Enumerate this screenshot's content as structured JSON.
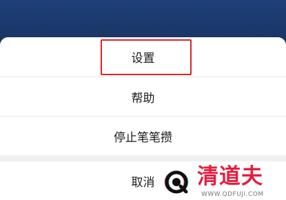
{
  "menu": {
    "items": [
      {
        "label": "设置"
      },
      {
        "label": "帮助"
      },
      {
        "label": "停止笔笔攒"
      }
    ],
    "cancel_label": "取消"
  },
  "annotation": {
    "highlight_color": "#e02020",
    "highlighted_item": "设置"
  },
  "watermark": {
    "brand": "清道夫",
    "url": "WWW.QDFUJI.COM"
  },
  "colors": {
    "backdrop": "#1e3f78",
    "sheet": "#ffffff",
    "separator": "#e6e6e6",
    "gap": "#f0f0f0",
    "text": "#1a1a1a",
    "watermark": "#e81c3f"
  }
}
